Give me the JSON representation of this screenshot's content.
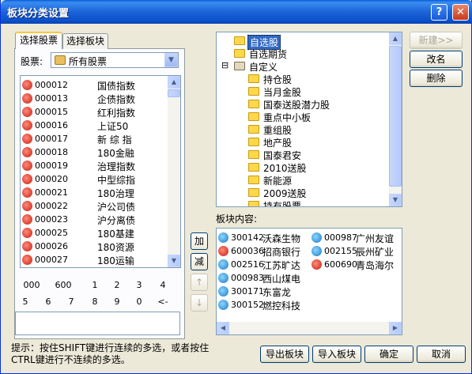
{
  "window": {
    "title": "板块分类设置",
    "help_label": "?",
    "close_label": "✕"
  },
  "tabs": [
    {
      "label": "选择股票"
    },
    {
      "label": "选择板块"
    }
  ],
  "stock_filter": {
    "label": "股票:",
    "selected": "所有股票"
  },
  "stocks": [
    {
      "code": "000012",
      "name": "国债指数",
      "icon": "red"
    },
    {
      "code": "000013",
      "name": "企债指数",
      "icon": "red"
    },
    {
      "code": "000015",
      "name": "红利指数",
      "icon": "red"
    },
    {
      "code": "000016",
      "name": "上证50",
      "icon": "red"
    },
    {
      "code": "000017",
      "name": "新 综 指",
      "icon": "red"
    },
    {
      "code": "000018",
      "name": "180金融",
      "icon": "red"
    },
    {
      "code": "000019",
      "name": "治理指数",
      "icon": "red"
    },
    {
      "code": "000020",
      "name": "中型综指",
      "icon": "red"
    },
    {
      "code": "000021",
      "name": "180治理",
      "icon": "red"
    },
    {
      "code": "000022",
      "name": "沪公司债",
      "icon": "red"
    },
    {
      "code": "000023",
      "name": "沪分离债",
      "icon": "red"
    },
    {
      "code": "000025",
      "name": "180基建",
      "icon": "red"
    },
    {
      "code": "000026",
      "name": "180资源",
      "icon": "red"
    },
    {
      "code": "000027",
      "name": "180运输",
      "icon": "red"
    }
  ],
  "keypad": {
    "row1": [
      "000",
      "600",
      "1",
      "2",
      "3",
      "4"
    ],
    "row2": [
      "5",
      "6",
      "7",
      "8",
      "9",
      "0",
      "<-"
    ]
  },
  "middle_buttons": {
    "add": "加",
    "remove": "减",
    "up": "↑",
    "down": "↓"
  },
  "tree": {
    "items": [
      {
        "label": "自选股",
        "selected": true
      },
      {
        "label": "自选期货"
      },
      {
        "label": "自定义",
        "expandable": true
      },
      {
        "label": "持仓股"
      },
      {
        "label": "当月金股"
      },
      {
        "label": "国泰送股潜力股"
      },
      {
        "label": "重点中小板"
      },
      {
        "label": "重组股"
      },
      {
        "label": "地产股"
      },
      {
        "label": "国泰君安"
      },
      {
        "label": "2010送股"
      },
      {
        "label": "新能源"
      },
      {
        "label": "2009送股"
      },
      {
        "label": "持有股票"
      }
    ],
    "expand_symbol": "⊟"
  },
  "right_buttons": {
    "new": "新建>>",
    "rename": "改名",
    "delete": "删除"
  },
  "block_content": {
    "label": "板块内容:",
    "col1": [
      {
        "code": "300142",
        "name": "沃森生物",
        "icon": "blue"
      },
      {
        "code": "600036",
        "name": "招商银行",
        "icon": "red"
      },
      {
        "code": "002516",
        "name": "江苏旷达",
        "icon": "blue"
      },
      {
        "code": "000983",
        "name": "西山煤电",
        "icon": "blue"
      },
      {
        "code": "300171",
        "name": "东富龙",
        "icon": "blue"
      },
      {
        "code": "300152",
        "name": "燃控科技",
        "icon": "blue"
      }
    ],
    "col2": [
      {
        "code": "000987",
        "name": "广州友谊",
        "icon": "blue"
      },
      {
        "code": "002155",
        "name": "辰州矿业",
        "icon": "blue"
      },
      {
        "code": "600690",
        "name": "青岛海尔",
        "icon": "red"
      }
    ]
  },
  "hint": "提示：按住SHIFT键进行连续的多选，或者按住CTRL键进行不连续的多选。",
  "bottom_buttons": {
    "export": "导出板块",
    "import": "导入板块",
    "ok": "确定",
    "cancel": "取消"
  }
}
